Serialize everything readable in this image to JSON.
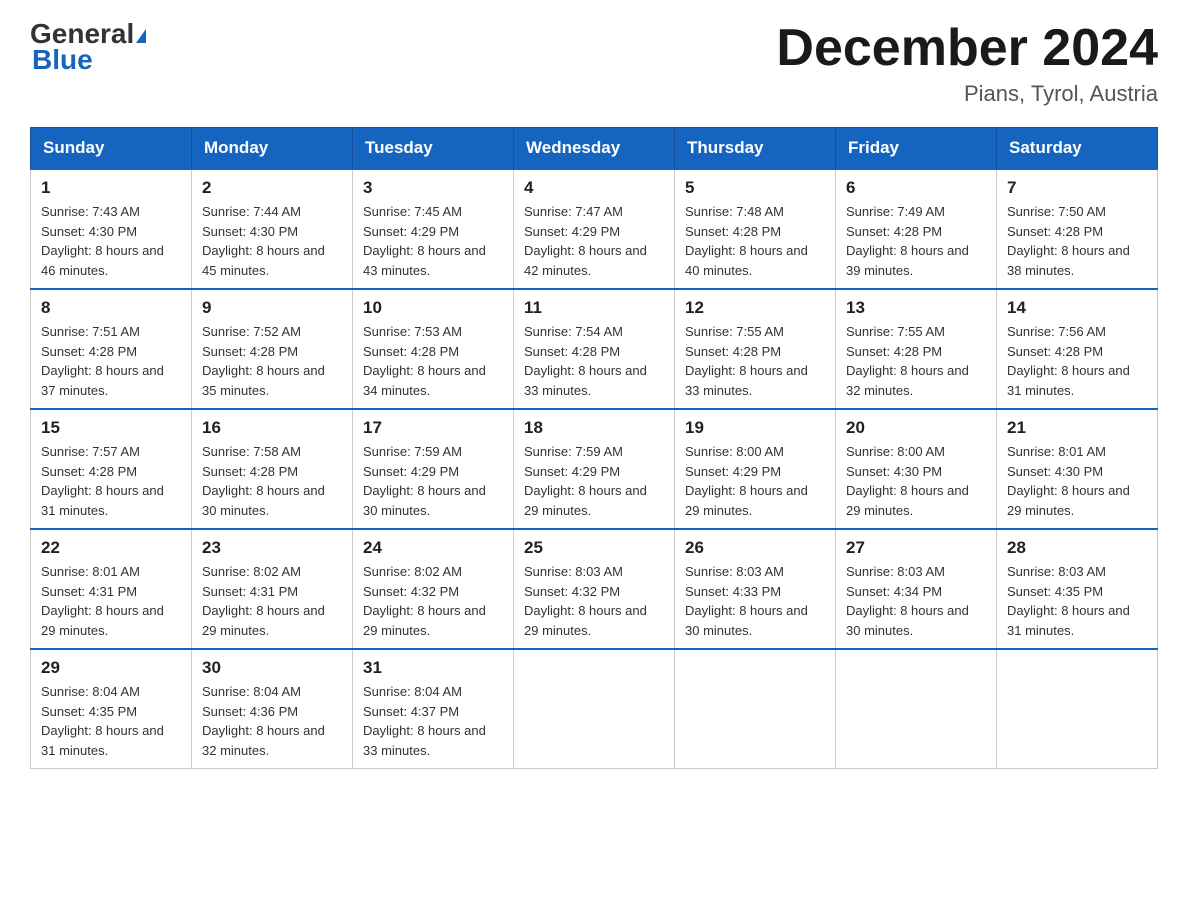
{
  "header": {
    "logo_line1": "General",
    "logo_line2": "Blue",
    "title": "December 2024",
    "subtitle": "Pians, Tyrol, Austria"
  },
  "days_of_week": [
    "Sunday",
    "Monday",
    "Tuesday",
    "Wednesday",
    "Thursday",
    "Friday",
    "Saturday"
  ],
  "weeks": [
    [
      {
        "day": "1",
        "sunrise": "7:43 AM",
        "sunset": "4:30 PM",
        "daylight": "8 hours and 46 minutes."
      },
      {
        "day": "2",
        "sunrise": "7:44 AM",
        "sunset": "4:30 PM",
        "daylight": "8 hours and 45 minutes."
      },
      {
        "day": "3",
        "sunrise": "7:45 AM",
        "sunset": "4:29 PM",
        "daylight": "8 hours and 43 minutes."
      },
      {
        "day": "4",
        "sunrise": "7:47 AM",
        "sunset": "4:29 PM",
        "daylight": "8 hours and 42 minutes."
      },
      {
        "day": "5",
        "sunrise": "7:48 AM",
        "sunset": "4:28 PM",
        "daylight": "8 hours and 40 minutes."
      },
      {
        "day": "6",
        "sunrise": "7:49 AM",
        "sunset": "4:28 PM",
        "daylight": "8 hours and 39 minutes."
      },
      {
        "day": "7",
        "sunrise": "7:50 AM",
        "sunset": "4:28 PM",
        "daylight": "8 hours and 38 minutes."
      }
    ],
    [
      {
        "day": "8",
        "sunrise": "7:51 AM",
        "sunset": "4:28 PM",
        "daylight": "8 hours and 37 minutes."
      },
      {
        "day": "9",
        "sunrise": "7:52 AM",
        "sunset": "4:28 PM",
        "daylight": "8 hours and 35 minutes."
      },
      {
        "day": "10",
        "sunrise": "7:53 AM",
        "sunset": "4:28 PM",
        "daylight": "8 hours and 34 minutes."
      },
      {
        "day": "11",
        "sunrise": "7:54 AM",
        "sunset": "4:28 PM",
        "daylight": "8 hours and 33 minutes."
      },
      {
        "day": "12",
        "sunrise": "7:55 AM",
        "sunset": "4:28 PM",
        "daylight": "8 hours and 33 minutes."
      },
      {
        "day": "13",
        "sunrise": "7:55 AM",
        "sunset": "4:28 PM",
        "daylight": "8 hours and 32 minutes."
      },
      {
        "day": "14",
        "sunrise": "7:56 AM",
        "sunset": "4:28 PM",
        "daylight": "8 hours and 31 minutes."
      }
    ],
    [
      {
        "day": "15",
        "sunrise": "7:57 AM",
        "sunset": "4:28 PM",
        "daylight": "8 hours and 31 minutes."
      },
      {
        "day": "16",
        "sunrise": "7:58 AM",
        "sunset": "4:28 PM",
        "daylight": "8 hours and 30 minutes."
      },
      {
        "day": "17",
        "sunrise": "7:59 AM",
        "sunset": "4:29 PM",
        "daylight": "8 hours and 30 minutes."
      },
      {
        "day": "18",
        "sunrise": "7:59 AM",
        "sunset": "4:29 PM",
        "daylight": "8 hours and 29 minutes."
      },
      {
        "day": "19",
        "sunrise": "8:00 AM",
        "sunset": "4:29 PM",
        "daylight": "8 hours and 29 minutes."
      },
      {
        "day": "20",
        "sunrise": "8:00 AM",
        "sunset": "4:30 PM",
        "daylight": "8 hours and 29 minutes."
      },
      {
        "day": "21",
        "sunrise": "8:01 AM",
        "sunset": "4:30 PM",
        "daylight": "8 hours and 29 minutes."
      }
    ],
    [
      {
        "day": "22",
        "sunrise": "8:01 AM",
        "sunset": "4:31 PM",
        "daylight": "8 hours and 29 minutes."
      },
      {
        "day": "23",
        "sunrise": "8:02 AM",
        "sunset": "4:31 PM",
        "daylight": "8 hours and 29 minutes."
      },
      {
        "day": "24",
        "sunrise": "8:02 AM",
        "sunset": "4:32 PM",
        "daylight": "8 hours and 29 minutes."
      },
      {
        "day": "25",
        "sunrise": "8:03 AM",
        "sunset": "4:32 PM",
        "daylight": "8 hours and 29 minutes."
      },
      {
        "day": "26",
        "sunrise": "8:03 AM",
        "sunset": "4:33 PM",
        "daylight": "8 hours and 30 minutes."
      },
      {
        "day": "27",
        "sunrise": "8:03 AM",
        "sunset": "4:34 PM",
        "daylight": "8 hours and 30 minutes."
      },
      {
        "day": "28",
        "sunrise": "8:03 AM",
        "sunset": "4:35 PM",
        "daylight": "8 hours and 31 minutes."
      }
    ],
    [
      {
        "day": "29",
        "sunrise": "8:04 AM",
        "sunset": "4:35 PM",
        "daylight": "8 hours and 31 minutes."
      },
      {
        "day": "30",
        "sunrise": "8:04 AM",
        "sunset": "4:36 PM",
        "daylight": "8 hours and 32 minutes."
      },
      {
        "day": "31",
        "sunrise": "8:04 AM",
        "sunset": "4:37 PM",
        "daylight": "8 hours and 33 minutes."
      },
      null,
      null,
      null,
      null
    ]
  ]
}
